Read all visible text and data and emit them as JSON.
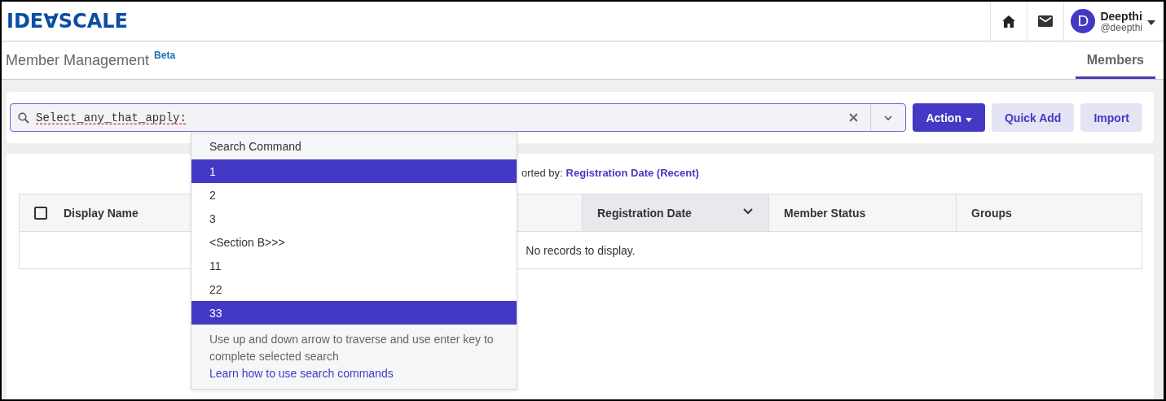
{
  "header": {
    "logo": "IDE∀SCALE",
    "user": {
      "initial": "D",
      "name": "Deepthi",
      "handle": "@deepthi"
    }
  },
  "page": {
    "title": "Member Management",
    "badge": "Beta",
    "tabs": [
      {
        "label": "Members",
        "selected": true
      }
    ]
  },
  "search": {
    "value": "Select_any_that_apply:"
  },
  "buttons": [
    {
      "label": "Action",
      "kind": "primary"
    },
    {
      "label": "Quick Add",
      "kind": "secondary"
    },
    {
      "label": "Import",
      "kind": "secondary"
    }
  ],
  "sort": {
    "label": "orted by:",
    "value": "Registration Date (Recent)"
  },
  "table": {
    "select_all": {
      "checked": false
    },
    "columns": [
      {
        "label": "Display Name",
        "sorted": false
      },
      {
        "label": "Registration Date",
        "sorted": true
      },
      {
        "label": "Member Status",
        "sorted": false
      },
      {
        "label": "Groups",
        "sorted": false
      }
    ],
    "empty_message": "No records to display."
  },
  "dropdown": {
    "title": "Search Command",
    "items": [
      {
        "label": "1",
        "selected": true
      },
      {
        "label": "2",
        "selected": false
      },
      {
        "label": "3",
        "selected": false
      },
      {
        "label": "<Section B>>>",
        "selected": false
      },
      {
        "label": "11",
        "selected": false
      },
      {
        "label": "22",
        "selected": false
      },
      {
        "label": "33",
        "selected": true
      }
    ],
    "hint": "Use up and down arrow to traverse and use enter key to complete selected search",
    "link": "Learn how to use search commands"
  }
}
